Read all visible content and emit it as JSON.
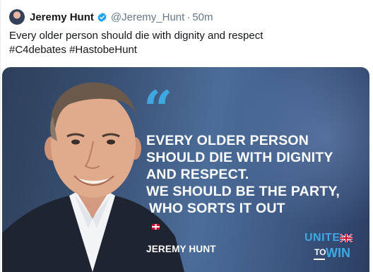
{
  "tweet": {
    "author_name": "Jeremy Hunt",
    "handle": "@Jeremy_Hunt",
    "separator": "·",
    "time": "50m",
    "text_lines": [
      "Every older person should die with dignity and respect",
      "#C4debates #HastobeHunt"
    ]
  },
  "media": {
    "quote_mark": "“",
    "quote_lines": [
      "EVERY OLDER PERSON",
      "SHOULD DIE WITH DIGNITY",
      "AND RESPECT.",
      "WE SHOULD BE THE PARTY,",
      "WHO SORTS IT OUT"
    ],
    "speaker": "JEREMY HUNT",
    "logo": {
      "unite": "UNITE",
      "to": "TO",
      "win": "WIN"
    }
  },
  "colors": {
    "verified": "#1da1f2",
    "accent_blue": "#3fa7e1",
    "text_primary": "#14171a",
    "text_secondary": "#657786"
  },
  "icons": {
    "verified": "verified-badge-icon",
    "flag": "union-jack-flag-icon"
  }
}
